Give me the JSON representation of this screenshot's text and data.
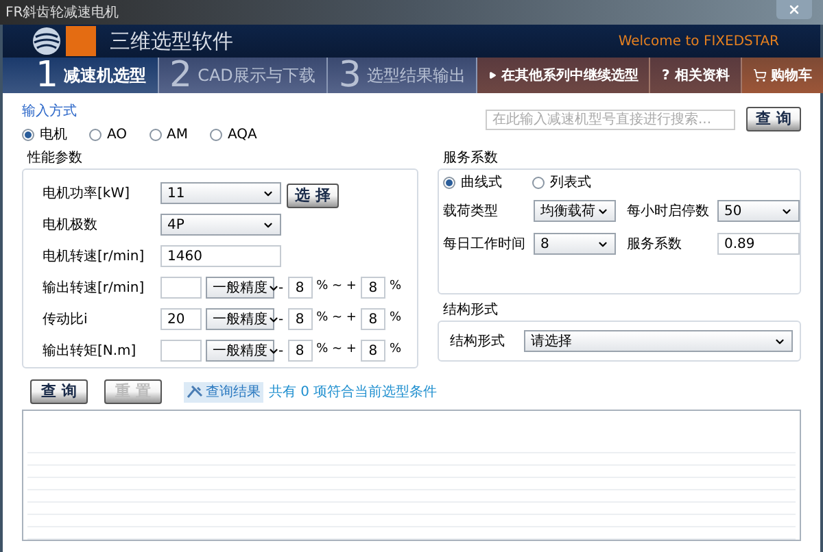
{
  "window": {
    "title": "FR斜齿轮减速电机"
  },
  "header": {
    "title": "三维选型软件",
    "welcome": "Welcome to FIXEDSTAR"
  },
  "steps": [
    {
      "number": "1",
      "label": "减速机选型",
      "selected": true
    },
    {
      "number": "2",
      "label": "CAD展示与下载",
      "selected": false
    },
    {
      "number": "3",
      "label": "选型结果输出",
      "selected": false
    }
  ],
  "links": [
    {
      "label": "在其他系列中继续选型",
      "kind": "arrow"
    },
    {
      "label": "? 相关资料",
      "kind": "text"
    },
    {
      "label": "购物车",
      "kind": "cart"
    }
  ],
  "input_mode": {
    "label": "输入方式",
    "options": [
      {
        "label": "电机",
        "selected": true
      },
      {
        "label": "AO",
        "selected": false
      },
      {
        "label": "AM",
        "selected": false
      },
      {
        "label": "AQA",
        "selected": false
      }
    ]
  },
  "search": {
    "placeholder": "在此输入减速机型号直接进行搜索...",
    "button": "查 询"
  },
  "performance": {
    "title": "性能参数",
    "rows": [
      {
        "kind": "select",
        "label": "电机功率[kW]",
        "value": "11",
        "button": "选 择"
      },
      {
        "kind": "select",
        "label": "电机极数",
        "value": "4P"
      },
      {
        "kind": "text",
        "label": "电机转速[r/min]",
        "value": "1460"
      },
      {
        "kind": "range",
        "label": "输出转速[r/min]",
        "value": "",
        "precision": "一般精度",
        "sep1": "-",
        "lower": "8",
        "sep2": "% ~ +",
        "upper": "8",
        "sep3": "%"
      },
      {
        "kind": "range",
        "label": "传动比i",
        "value": "20",
        "precision": "一般精度",
        "sep1": "-",
        "lower": "8",
        "sep2": "% ~ +",
        "upper": "8",
        "sep3": "%"
      },
      {
        "kind": "range",
        "label": "输出转矩[N.m]",
        "value": "",
        "precision": "一般精度",
        "sep1": "-",
        "lower": "8",
        "sep2": "% ~ +",
        "upper": "8",
        "sep3": "%"
      }
    ]
  },
  "service": {
    "title": "服务系数",
    "modes": [
      {
        "label": "曲线式",
        "selected": true
      },
      {
        "label": "列表式",
        "selected": false
      }
    ],
    "fields": [
      {
        "kind": "select",
        "label": "载荷类型",
        "value": "均衡载荷"
      },
      {
        "kind": "select",
        "label": "每小时启停数",
        "value": "50"
      },
      {
        "kind": "select",
        "label": "每日工作时间",
        "value": "8"
      },
      {
        "kind": "text",
        "label": "服务系数",
        "value": "0.89"
      }
    ]
  },
  "structure": {
    "title": "结构形式",
    "label": "结构形式",
    "value": "请选择"
  },
  "actions": [
    {
      "label": "查 询",
      "disabled": false
    },
    {
      "label": "重 置",
      "disabled": true
    }
  ],
  "result": {
    "label": "查询结果",
    "summary": "共有 0 项符合当前选型条件"
  }
}
